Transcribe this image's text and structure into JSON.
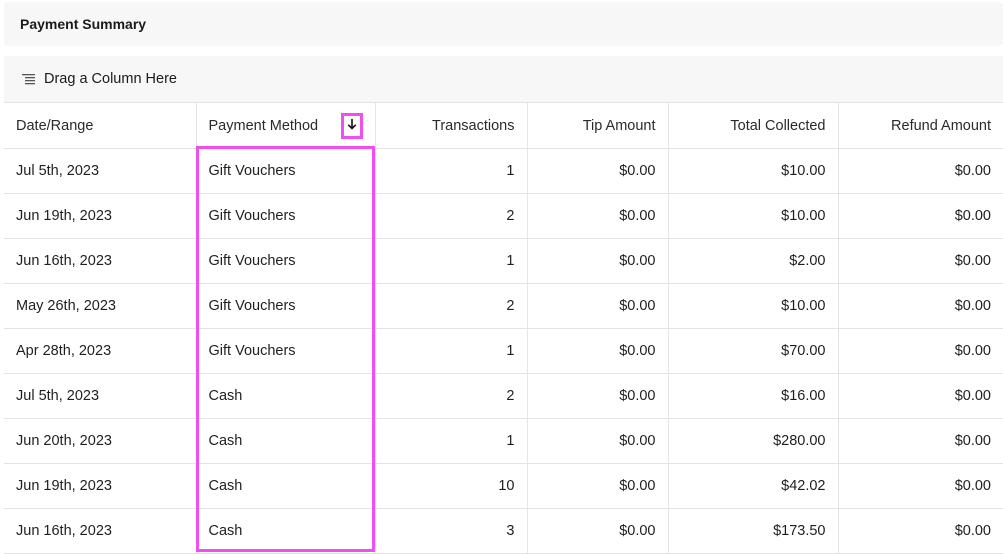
{
  "panel": {
    "title": "Payment Summary"
  },
  "group_bar": {
    "label": "Drag a Column Here",
    "icon": "drag-group-icon"
  },
  "columns": [
    {
      "label": "Date/Range"
    },
    {
      "label": "Payment Method",
      "sort": "descending",
      "sort_icon": "arrow-down-icon"
    },
    {
      "label": "Transactions"
    },
    {
      "label": "Tip Amount"
    },
    {
      "label": "Total Collected"
    },
    {
      "label": "Refund Amount"
    }
  ],
  "rows": [
    [
      "Jul 5th, 2023",
      "Gift Vouchers",
      "1",
      "$0.00",
      "$10.00",
      "$0.00"
    ],
    [
      "Jun 19th, 2023",
      "Gift Vouchers",
      "2",
      "$0.00",
      "$10.00",
      "$0.00"
    ],
    [
      "Jun 16th, 2023",
      "Gift Vouchers",
      "1",
      "$0.00",
      "$2.00",
      "$0.00"
    ],
    [
      "May 26th, 2023",
      "Gift Vouchers",
      "2",
      "$0.00",
      "$10.00",
      "$0.00"
    ],
    [
      "Apr 28th, 2023",
      "Gift Vouchers",
      "1",
      "$0.00",
      "$70.00",
      "$0.00"
    ],
    [
      "Jul 5th, 2023",
      "Cash",
      "2",
      "$0.00",
      "$16.00",
      "$0.00"
    ],
    [
      "Jun 20th, 2023",
      "Cash",
      "1",
      "$0.00",
      "$280.00",
      "$0.00"
    ],
    [
      "Jun 19th, 2023",
      "Cash",
      "10",
      "$0.00",
      "$42.02",
      "$0.00"
    ],
    [
      "Jun 16th, 2023",
      "Cash",
      "3",
      "$0.00",
      "$173.50",
      "$0.00"
    ]
  ],
  "colors": {
    "highlight": "#f04ff0",
    "header_bg": "#f7f7f7",
    "border": "#e4e4e4"
  }
}
